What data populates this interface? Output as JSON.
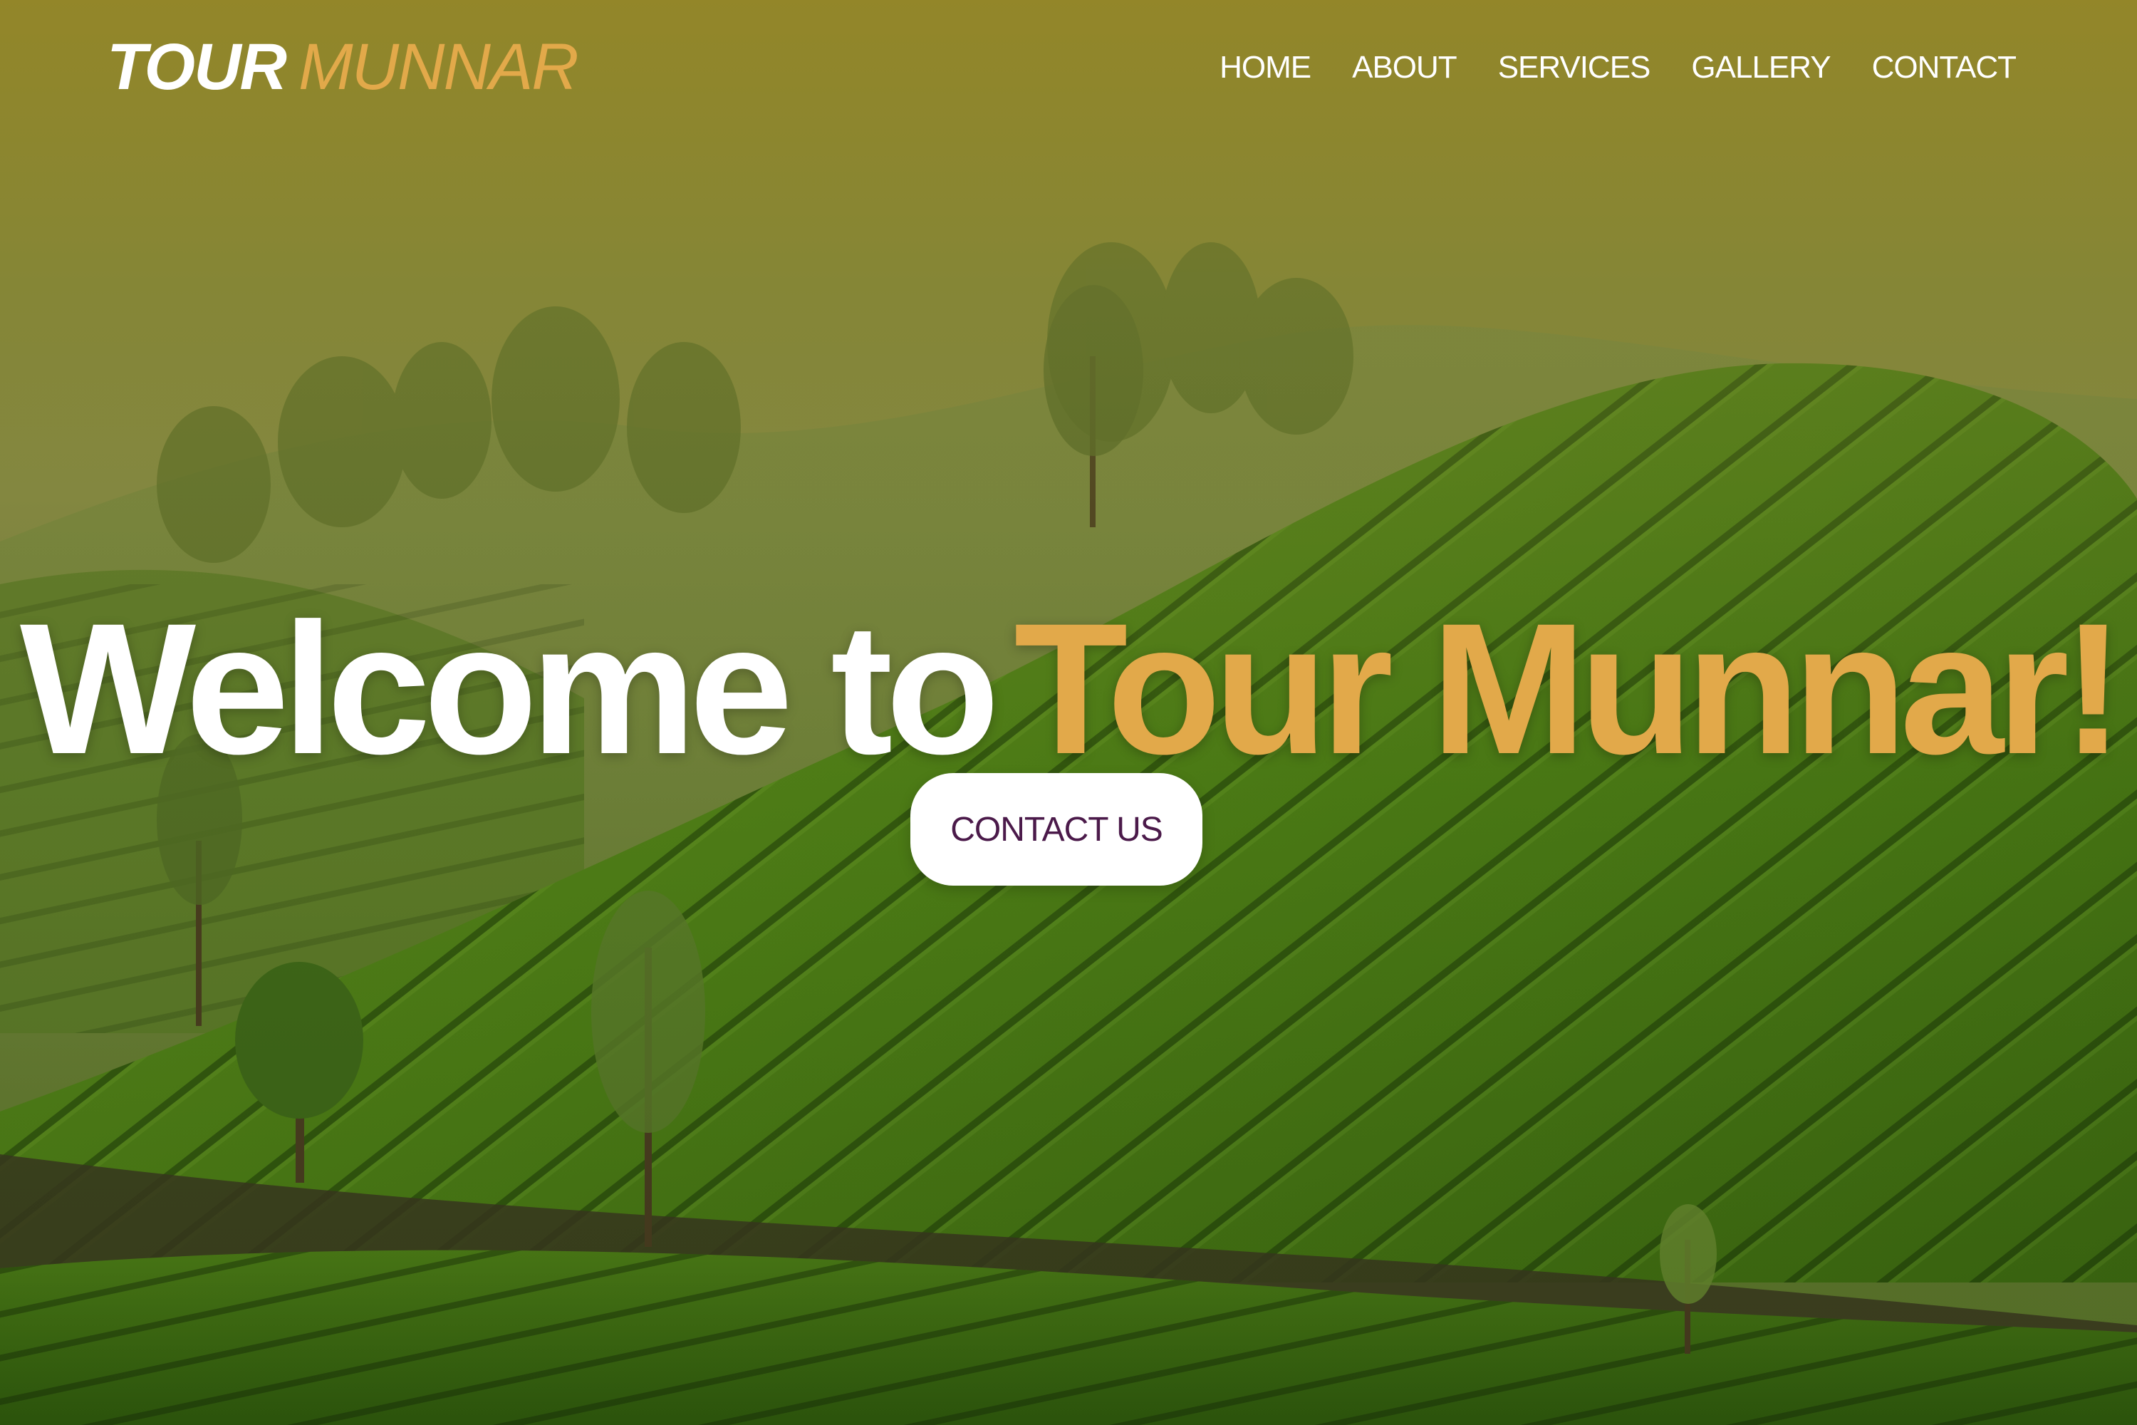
{
  "brand": {
    "part1": "TOUR",
    "part2": "MUNNAR"
  },
  "nav": {
    "items": [
      {
        "label": "HOME"
      },
      {
        "label": "ABOUT"
      },
      {
        "label": "SERVICES"
      },
      {
        "label": "GALLERY"
      },
      {
        "label": "CONTACT"
      }
    ]
  },
  "hero": {
    "title_part1": "Welcome to",
    "title_part2": "Tour Munnar!",
    "cta_label": "CONTACT US"
  },
  "colors": {
    "accent": "#e2a94a",
    "nav_text": "#ffffff",
    "cta_text": "#4b1a4a",
    "cta_bg": "#ffffff"
  }
}
